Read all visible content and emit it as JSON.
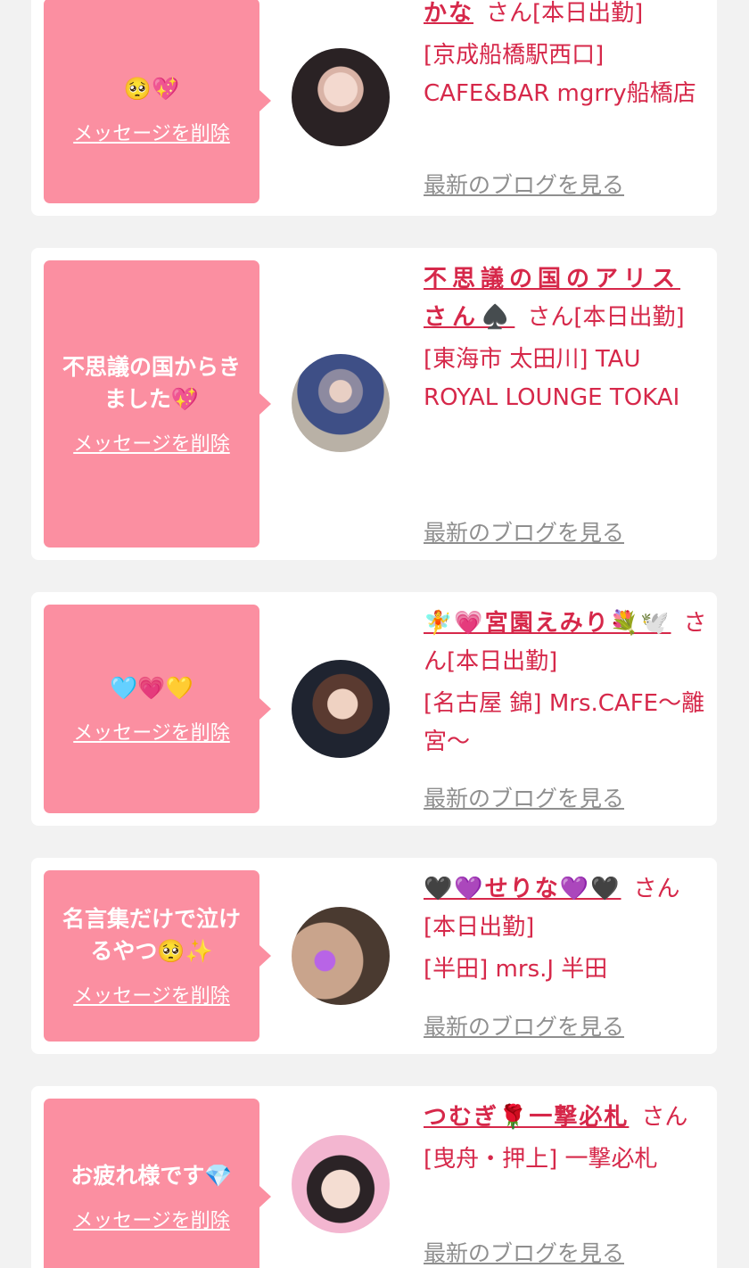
{
  "cards": [
    {
      "message": "🥺💖",
      "delete_label": "メッセージを削除",
      "name": "かな",
      "suffix": "さん[本日出勤]",
      "shop": "[京成船橋駅西口] CAFE&BAR mgrry船橋店",
      "blog_label": "最新のブログを見る"
    },
    {
      "message": "不思議の国からきました💖",
      "delete_label": "メッセージを削除",
      "name": "不思議の国のアリスさん♠️",
      "suffix": "さん[本日出勤]",
      "shop": "[東海市 太田川] TAU ROYAL LOUNGE TOKAI",
      "blog_label": "最新のブログを見る"
    },
    {
      "message": "🩵💗💛",
      "delete_label": "メッセージを削除",
      "name": "🧚💗宮園えみり💐🕊️",
      "suffix": "さん[本日出勤]",
      "shop": "[名古屋 錦] Mrs.CAFE〜離宮〜",
      "blog_label": "最新のブログを見る"
    },
    {
      "message": "名言集だけで泣けるやつ🥺✨",
      "delete_label": "メッセージを削除",
      "name": "🖤💜せりな💜🖤",
      "suffix": "さん[本日出勤]",
      "shop": "[半田] mrs.J 半田",
      "blog_label": "最新のブログを見る"
    },
    {
      "message": "お疲れ様です💎",
      "delete_label": "メッセージを削除",
      "name": "つむぎ🌹一撃必札",
      "suffix": "さん",
      "shop": "[曳舟・押上] 一撃必札",
      "blog_label": "最新のブログを見る"
    }
  ],
  "colors": {
    "page_background": "#f2f2f2",
    "card_background": "#ffffff",
    "bubble": "#fb8fa1",
    "accent_text": "#d6284a",
    "muted_link": "#8f8f8f"
  }
}
